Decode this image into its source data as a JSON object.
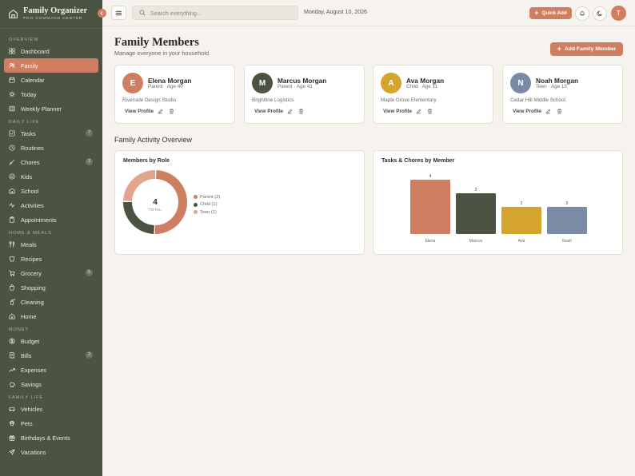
{
  "app": {
    "title": "Family Organizer",
    "subtitle": "PRO COMMAND CENTER"
  },
  "sidebar": {
    "sections": [
      {
        "title": "OVERVIEW",
        "items": [
          {
            "label": "Dashboard",
            "icon": "grid-icon"
          },
          {
            "label": "Family",
            "icon": "users-icon",
            "active": true
          },
          {
            "label": "Calendar",
            "icon": "calendar-icon"
          },
          {
            "label": "Today",
            "icon": "sun-icon"
          },
          {
            "label": "Weekly Planner",
            "icon": "columns-icon"
          }
        ]
      },
      {
        "title": "DAILY LIFE",
        "items": [
          {
            "label": "Tasks",
            "icon": "check-square-icon",
            "badge": "7"
          },
          {
            "label": "Routines",
            "icon": "clock-icon"
          },
          {
            "label": "Chores",
            "icon": "brush-icon",
            "badge": "3"
          },
          {
            "label": "Kids",
            "icon": "baby-icon"
          },
          {
            "label": "School",
            "icon": "school-icon"
          },
          {
            "label": "Activities",
            "icon": "activity-icon"
          },
          {
            "label": "Appointments",
            "icon": "clipboard-icon"
          }
        ]
      },
      {
        "title": "HOME & MEALS",
        "items": [
          {
            "label": "Meals",
            "icon": "utensils-icon"
          },
          {
            "label": "Recipes",
            "icon": "chef-hat-icon"
          },
          {
            "label": "Grocery",
            "icon": "cart-icon",
            "badge": "5"
          },
          {
            "label": "Shopping",
            "icon": "bag-icon"
          },
          {
            "label": "Cleaning",
            "icon": "spray-icon"
          },
          {
            "label": "Home",
            "icon": "home-icon"
          }
        ]
      },
      {
        "title": "MONEY",
        "items": [
          {
            "label": "Budget",
            "icon": "dollar-icon"
          },
          {
            "label": "Bills",
            "icon": "receipt-icon",
            "badge": "2"
          },
          {
            "label": "Expenses",
            "icon": "trending-icon"
          },
          {
            "label": "Savings",
            "icon": "piggy-icon"
          }
        ]
      },
      {
        "title": "FAMILY LIFE",
        "items": [
          {
            "label": "Vehicles",
            "icon": "car-icon"
          },
          {
            "label": "Pets",
            "icon": "paw-icon"
          },
          {
            "label": "Birthdays & Events",
            "icon": "gift-icon"
          },
          {
            "label": "Vacations",
            "icon": "plane-icon"
          }
        ]
      }
    ]
  },
  "topbar": {
    "search_placeholder": "Search everything...",
    "date": "Monday, August 10, 2026",
    "quick_add": "Quick Add",
    "user_initial": "T"
  },
  "main": {
    "title": "Family Members",
    "subtitle": "Manage everyone in your household.",
    "add_button": "Add Family Member",
    "members": [
      {
        "initial": "E",
        "name": "Elena Morgan",
        "role": "Parent · Age 40",
        "org": "Riverside Design Studio",
        "color": "#cf7e62"
      },
      {
        "initial": "M",
        "name": "Marcus Morgan",
        "role": "Parent · Age 41",
        "org": "Brightline Logistics",
        "color": "#4b5443"
      },
      {
        "initial": "A",
        "name": "Ava Morgan",
        "role": "Child · Age 11",
        "org": "Maple Grove Elementary",
        "color": "#d4a42c"
      },
      {
        "initial": "N",
        "name": "Noah Morgan",
        "role": "Teen · Age 15",
        "org": "Cedar Hill Middle School",
        "color": "#7b8ba6"
      }
    ],
    "view_profile": "View Profile",
    "activity_title": "Family Activity Overview"
  },
  "chart_data": [
    {
      "type": "pie",
      "title": "Members by Role",
      "center_value": "4",
      "center_label": "TOTAL",
      "categories": [
        "Parent (2)",
        "Child (1)",
        "Teen (1)"
      ],
      "values": [
        2,
        1,
        1
      ],
      "colors": [
        "#cf7e62",
        "#4b5443",
        "#e1a48c"
      ],
      "legend": "right"
    },
    {
      "type": "bar",
      "title": "Tasks & Chores by Member",
      "categories": [
        "Elena",
        "Marcus",
        "Ava",
        "Noah"
      ],
      "values": [
        4,
        3,
        2,
        2
      ],
      "colors": [
        "#cf7e62",
        "#4b5443",
        "#d4a42c",
        "#7b8ba6"
      ],
      "ylim": [
        0,
        4
      ]
    }
  ]
}
